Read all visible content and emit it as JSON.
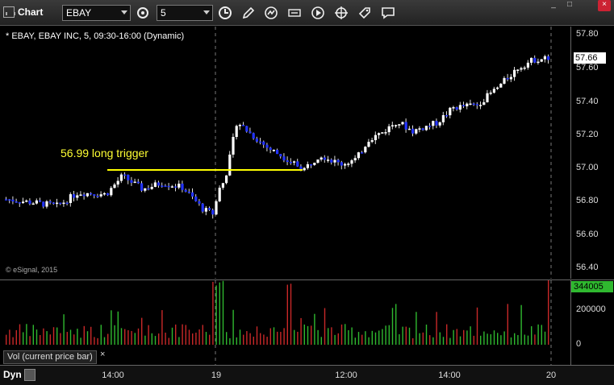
{
  "titlebar": {
    "app_title": "Chart",
    "symbol_value": "EBAY",
    "interval_value": "5",
    "window_controls": [
      "_",
      "□",
      "×"
    ]
  },
  "chart": {
    "legend": "* EBAY, EBAY INC, 5, 09:30-16:00 (Dynamic)",
    "copyright": "© eSignal, 2015",
    "trigger_label": "56.99 long trigger",
    "last_price": "57.66",
    "price_ticks": [
      "57.80",
      "57.60",
      "57.40",
      "57.20",
      "57.00",
      "56.80",
      "56.60",
      "56.40"
    ]
  },
  "volume": {
    "label": "Vol (current price bar)",
    "close_glyph": "×",
    "last_value": "344005",
    "ticks": [
      "200000",
      "0"
    ]
  },
  "time_axis": {
    "dyn_label": "Dyn",
    "ticks": [
      "14:00",
      "19",
      "12:00",
      "14:00",
      "20"
    ]
  },
  "colors": {
    "up": "#ffffff",
    "down": "#2233ff",
    "trigger_line": "#ffff00",
    "vol_up": "#2fb82f",
    "vol_down": "#c82828"
  }
}
